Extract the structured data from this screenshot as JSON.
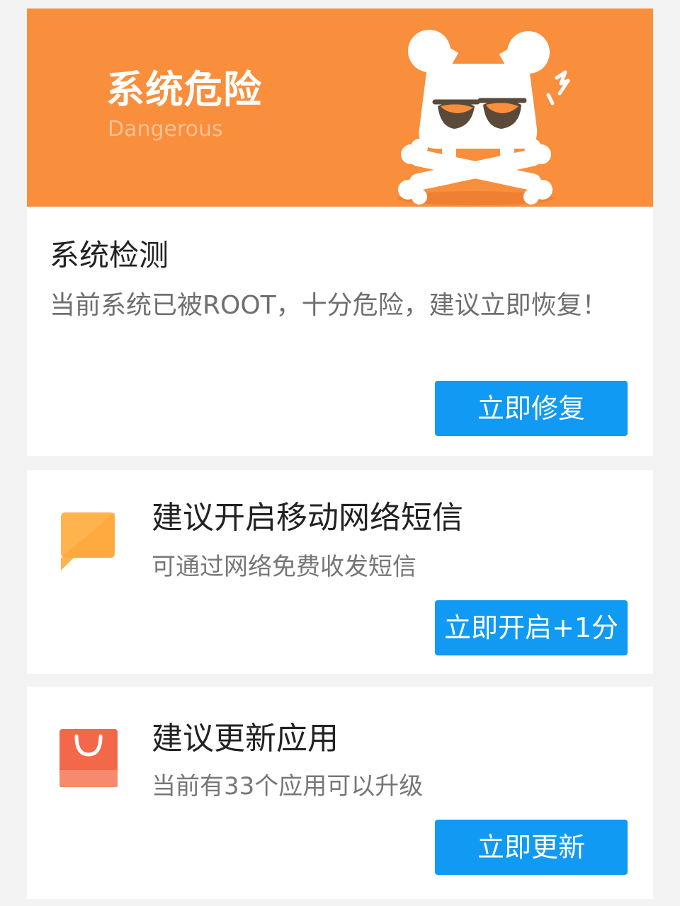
{
  "banner": {
    "title": "系统危险",
    "subtitle": "Dangerous",
    "icon": "skull-crossbones-icon",
    "color": "#f98e3c"
  },
  "system_check": {
    "title": "系统检测",
    "description": "当前系统已被ROOT，十分危险，建议立即恢复！",
    "button_label": "立即修复"
  },
  "sms_card": {
    "icon": "message-bubble-icon",
    "title": "建议开启移动网络短信",
    "description": "可通过网络免费收发短信",
    "button_label": "立即开启+1分"
  },
  "update_card": {
    "icon": "shopping-bag-icon",
    "title": "建议更新应用",
    "description": "当前有33个应用可以升级",
    "button_label": "立即更新"
  },
  "colors": {
    "accent_button": "#109af3",
    "banner": "#f98e3c"
  }
}
